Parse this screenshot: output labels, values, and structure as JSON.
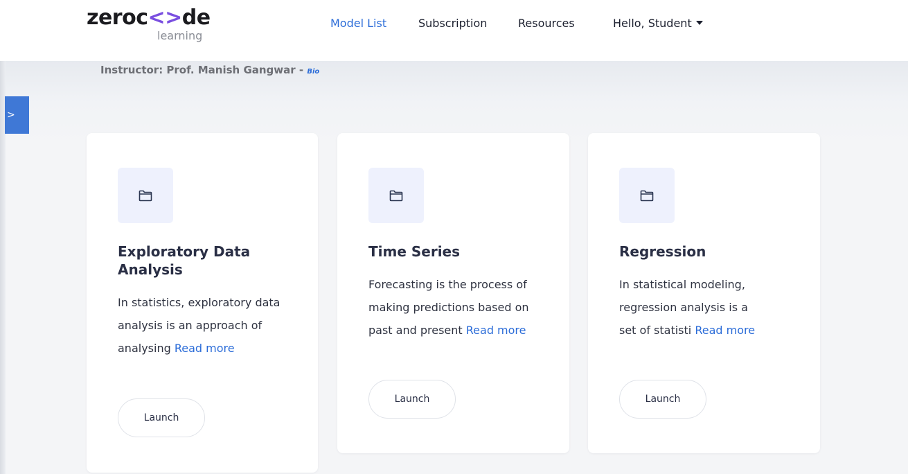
{
  "header": {
    "logo_main_left": "zeroc",
    "logo_brackets": "<>",
    "logo_main_right": "de",
    "logo_sub": "learning",
    "nav": [
      {
        "label": "Model List",
        "active": true
      },
      {
        "label": "Subscription",
        "active": false
      },
      {
        "label": "Resources",
        "active": false
      },
      {
        "label": "Hello, Student",
        "active": false
      }
    ]
  },
  "instructor": {
    "text": "Instructor: Prof. Manish Gangwar - ",
    "bio_label": "Bio"
  },
  "side_toggle_label": ">",
  "cards": [
    {
      "title": "Exploratory Data Analysis",
      "description": "In statistics, exploratory data analysis is an approach of analysing",
      "read_more": "Read more",
      "button": "Launch",
      "icon": "folder-icon"
    },
    {
      "title": "Time Series",
      "description": "Forecasting is the process of making predictions based on past and present",
      "read_more": "Read more",
      "button": "Launch",
      "icon": "folder-icon"
    },
    {
      "title": "Regression",
      "description": "In statistical modeling, regression analysis is a set of statisti",
      "read_more": "Read more",
      "button": "Launch",
      "icon": "folder-icon"
    }
  ],
  "colors": {
    "accent": "#2b6cd8",
    "logo_accent": "#7a4fe0",
    "toggle": "#3f78d6",
    "icon_bg": "#eef1fd"
  }
}
